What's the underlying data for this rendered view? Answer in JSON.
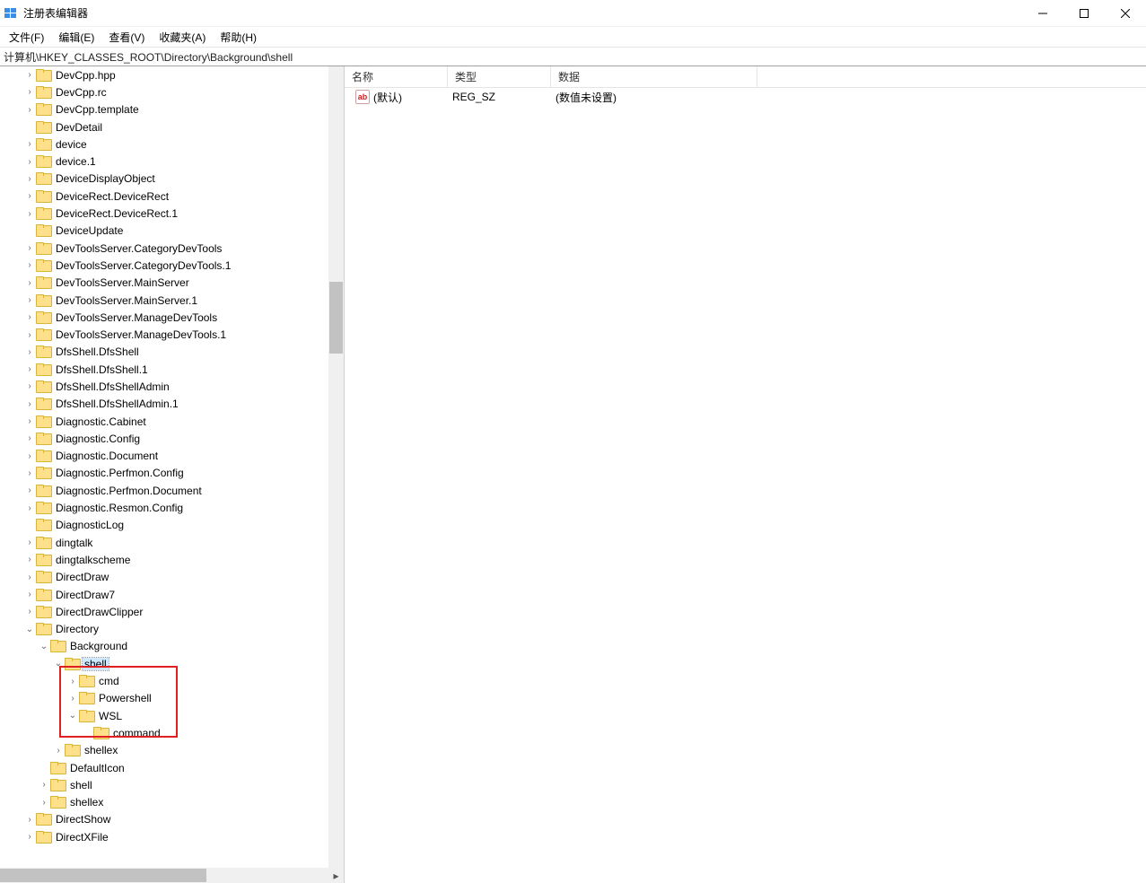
{
  "window": {
    "title": "注册表编辑器"
  },
  "menu": {
    "file": "文件(F)",
    "edit": "编辑(E)",
    "view": "查看(V)",
    "favorites": "收藏夹(A)",
    "help": "帮助(H)"
  },
  "address": "计算机\\HKEY_CLASSES_ROOT\\Directory\\Background\\shell",
  "tree": [
    {
      "label": "DevCpp.hpp",
      "indent": 1,
      "tw": ">"
    },
    {
      "label": "DevCpp.rc",
      "indent": 1,
      "tw": ">"
    },
    {
      "label": "DevCpp.template",
      "indent": 1,
      "tw": ">"
    },
    {
      "label": "DevDetail",
      "indent": 1,
      "tw": ""
    },
    {
      "label": "device",
      "indent": 1,
      "tw": ">"
    },
    {
      "label": "device.1",
      "indent": 1,
      "tw": ">"
    },
    {
      "label": "DeviceDisplayObject",
      "indent": 1,
      "tw": ">"
    },
    {
      "label": "DeviceRect.DeviceRect",
      "indent": 1,
      "tw": ">"
    },
    {
      "label": "DeviceRect.DeviceRect.1",
      "indent": 1,
      "tw": ">"
    },
    {
      "label": "DeviceUpdate",
      "indent": 1,
      "tw": ""
    },
    {
      "label": "DevToolsServer.CategoryDevTools",
      "indent": 1,
      "tw": ">"
    },
    {
      "label": "DevToolsServer.CategoryDevTools.1",
      "indent": 1,
      "tw": ">"
    },
    {
      "label": "DevToolsServer.MainServer",
      "indent": 1,
      "tw": ">"
    },
    {
      "label": "DevToolsServer.MainServer.1",
      "indent": 1,
      "tw": ">"
    },
    {
      "label": "DevToolsServer.ManageDevTools",
      "indent": 1,
      "tw": ">"
    },
    {
      "label": "DevToolsServer.ManageDevTools.1",
      "indent": 1,
      "tw": ">"
    },
    {
      "label": "DfsShell.DfsShell",
      "indent": 1,
      "tw": ">"
    },
    {
      "label": "DfsShell.DfsShell.1",
      "indent": 1,
      "tw": ">"
    },
    {
      "label": "DfsShell.DfsShellAdmin",
      "indent": 1,
      "tw": ">"
    },
    {
      "label": "DfsShell.DfsShellAdmin.1",
      "indent": 1,
      "tw": ">"
    },
    {
      "label": "Diagnostic.Cabinet",
      "indent": 1,
      "tw": ">"
    },
    {
      "label": "Diagnostic.Config",
      "indent": 1,
      "tw": ">"
    },
    {
      "label": "Diagnostic.Document",
      "indent": 1,
      "tw": ">"
    },
    {
      "label": "Diagnostic.Perfmon.Config",
      "indent": 1,
      "tw": ">"
    },
    {
      "label": "Diagnostic.Perfmon.Document",
      "indent": 1,
      "tw": ">"
    },
    {
      "label": "Diagnostic.Resmon.Config",
      "indent": 1,
      "tw": ">"
    },
    {
      "label": "DiagnosticLog",
      "indent": 1,
      "tw": ""
    },
    {
      "label": "dingtalk",
      "indent": 1,
      "tw": ">"
    },
    {
      "label": "dingtalkscheme",
      "indent": 1,
      "tw": ">"
    },
    {
      "label": "DirectDraw",
      "indent": 1,
      "tw": ">"
    },
    {
      "label": "DirectDraw7",
      "indent": 1,
      "tw": ">"
    },
    {
      "label": "DirectDrawClipper",
      "indent": 1,
      "tw": ">"
    },
    {
      "label": "Directory",
      "indent": 1,
      "tw": "v"
    },
    {
      "label": "Background",
      "indent": 2,
      "tw": "v"
    },
    {
      "label": "shell",
      "indent": 3,
      "tw": "v",
      "selected": true
    },
    {
      "label": "cmd",
      "indent": 4,
      "tw": ">"
    },
    {
      "label": "Powershell",
      "indent": 4,
      "tw": ">"
    },
    {
      "label": "WSL",
      "indent": 4,
      "tw": "v"
    },
    {
      "label": "command",
      "indent": 5,
      "tw": ""
    },
    {
      "label": "shellex",
      "indent": 3,
      "tw": ">"
    },
    {
      "label": "DefaultIcon",
      "indent": 2,
      "tw": ""
    },
    {
      "label": "shell",
      "indent": 2,
      "tw": ">"
    },
    {
      "label": "shellex",
      "indent": 2,
      "tw": ">"
    },
    {
      "label": "DirectShow",
      "indent": 1,
      "tw": ">"
    },
    {
      "label": "DirectXFile",
      "indent": 1,
      "tw": ">"
    }
  ],
  "list": {
    "headers": {
      "name": "名称",
      "type": "类型",
      "data": "数据"
    },
    "rows": [
      {
        "name": "(默认)",
        "type": "REG_SZ",
        "data": "(数值未设置)"
      }
    ]
  },
  "icons": {
    "ab": "ab"
  }
}
